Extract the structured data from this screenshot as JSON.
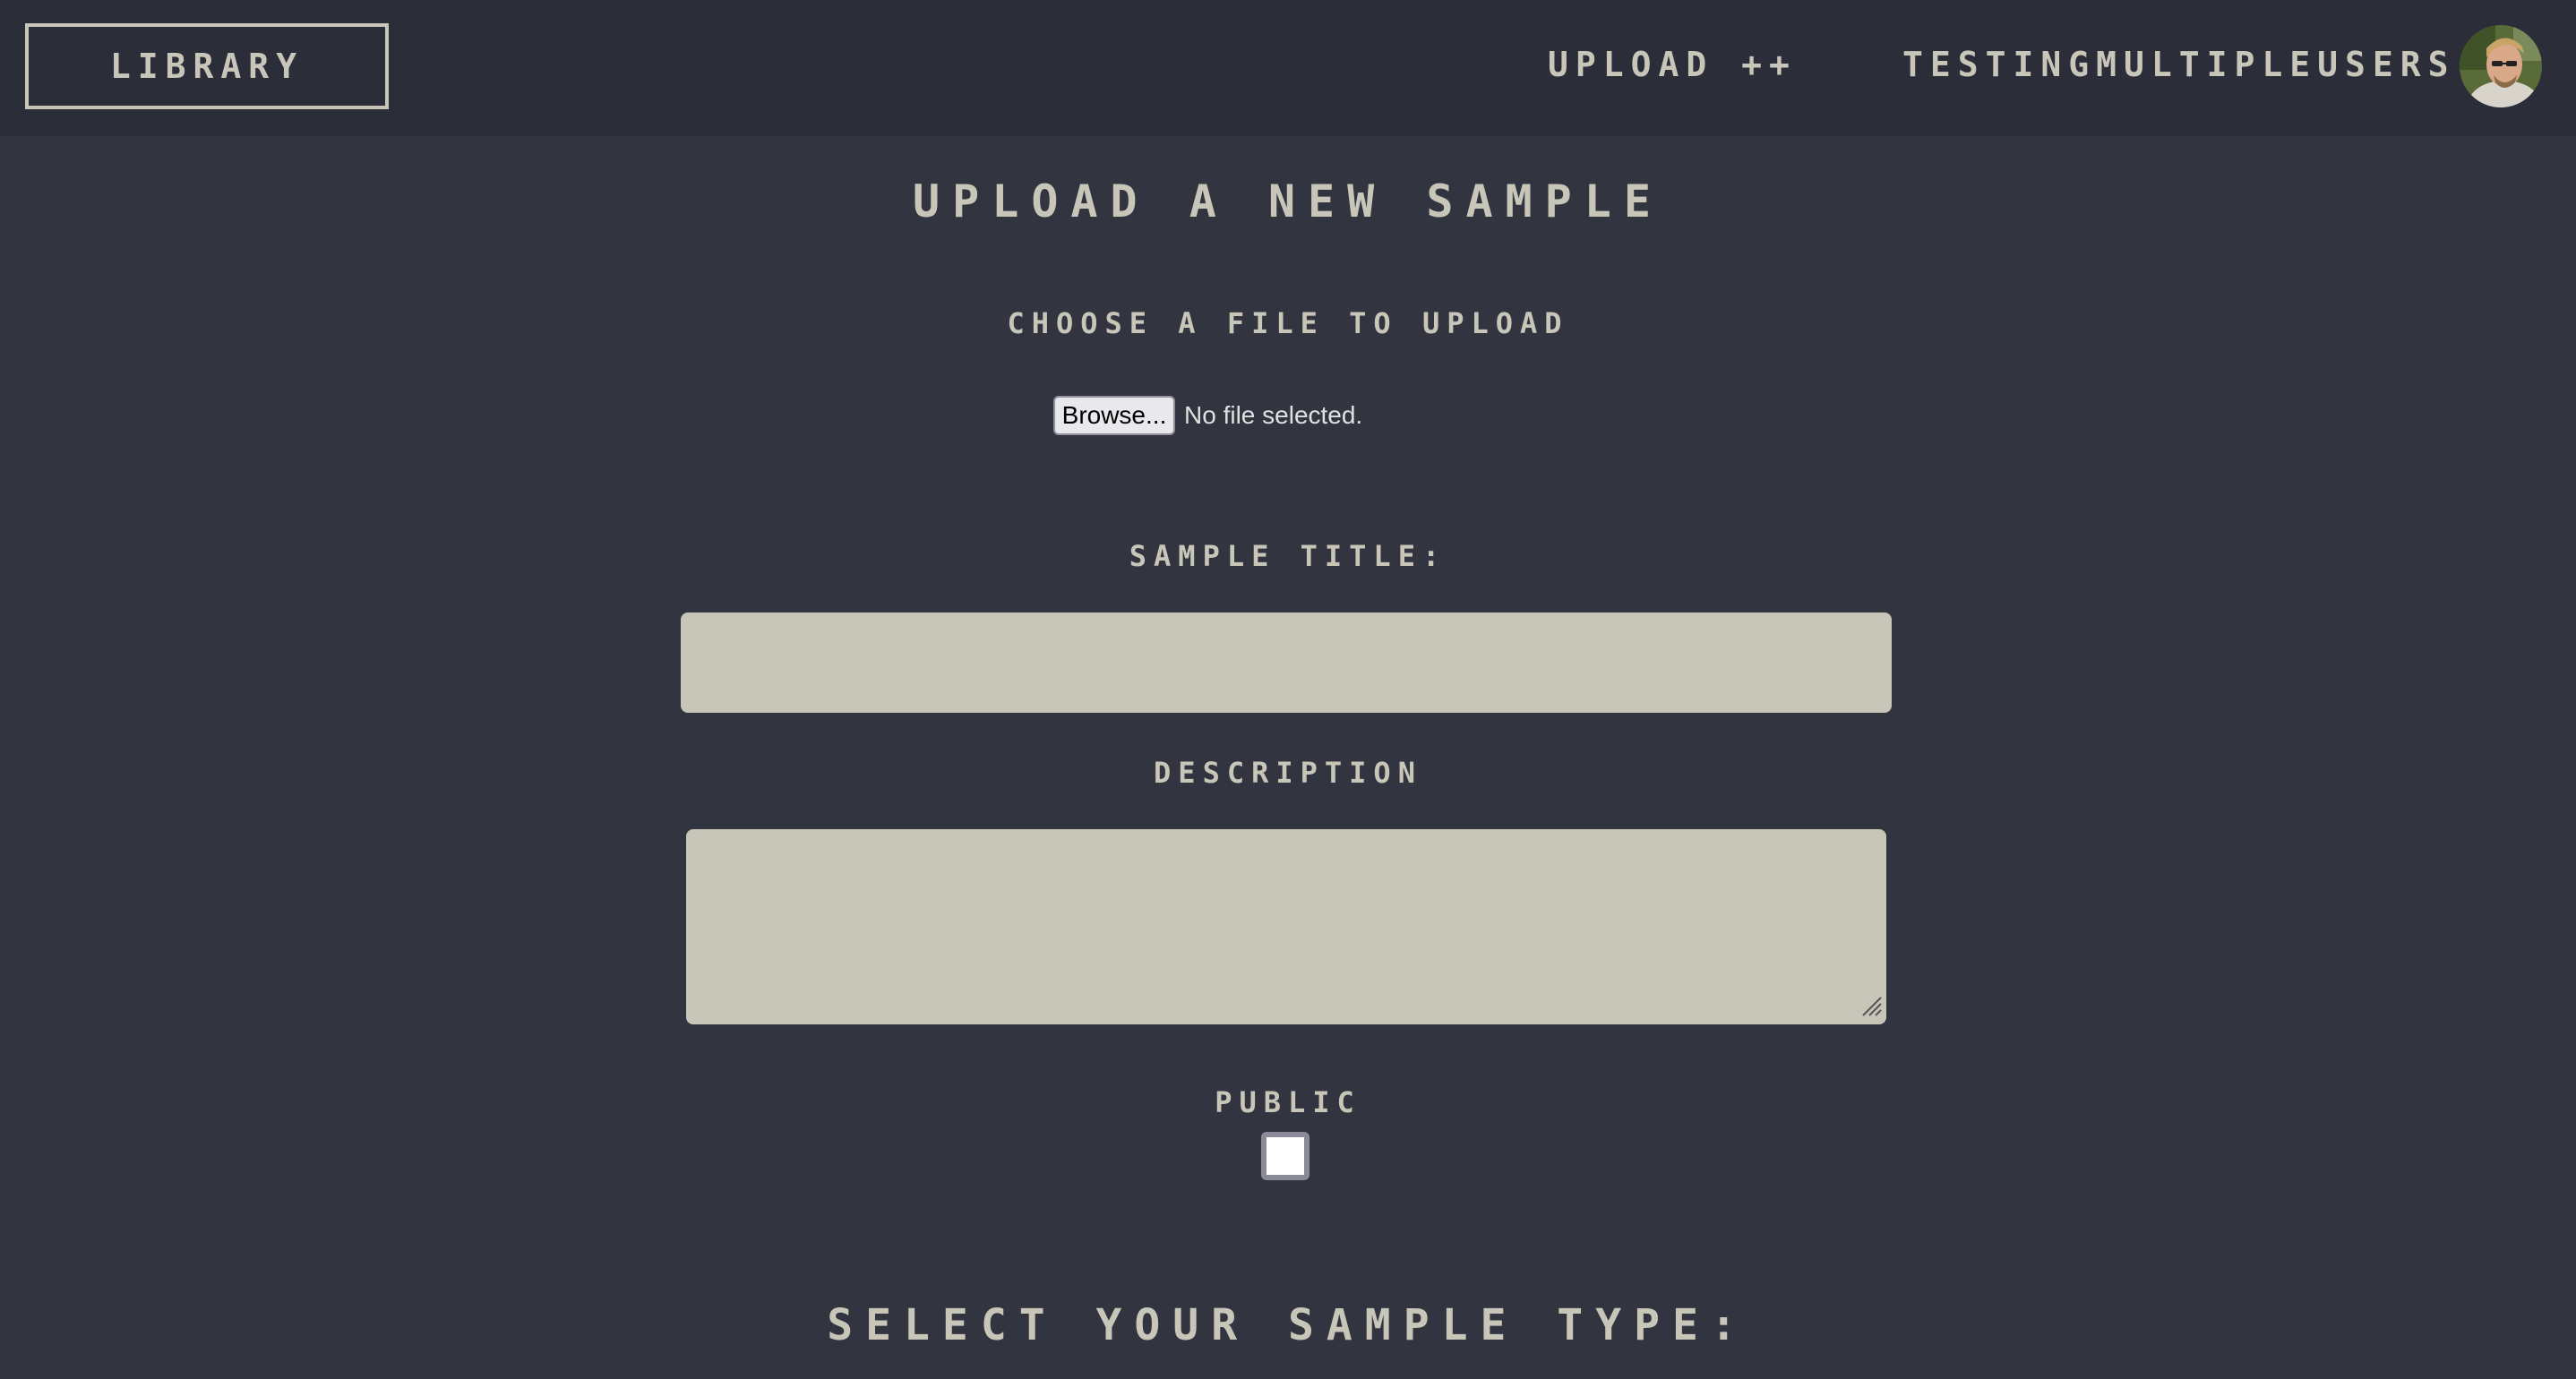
{
  "nav": {
    "library_label": "LIBRARY",
    "upload_label": "UPLOAD ++",
    "username": "TESTINGMULTIPLEUSERS"
  },
  "form": {
    "page_title": "UPLOAD A NEW SAMPLE",
    "file_label": "CHOOSE A FILE TO UPLOAD",
    "browse_label": "Browse...",
    "file_status": "No file selected.",
    "title_label": "SAMPLE TITLE:",
    "title_value": "",
    "description_label": "DESCRIPTION",
    "description_value": "",
    "public_label": "PUBLIC",
    "public_checked": false,
    "sample_type_heading": "SELECT YOUR SAMPLE TYPE:"
  },
  "colors": {
    "background": "#32343f",
    "navbar": "#2b2d38",
    "text": "#c8c6b8",
    "input_fill": "#c8c6b8"
  }
}
